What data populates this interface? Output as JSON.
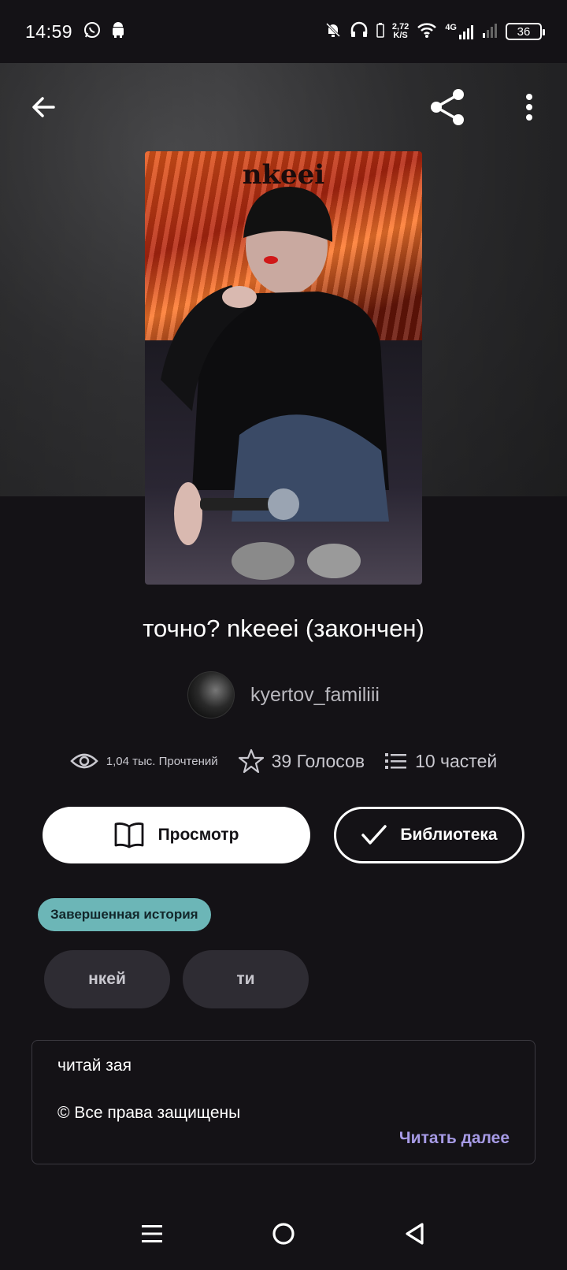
{
  "status_bar": {
    "time": "14:59",
    "net_speed_value": "2,72",
    "net_speed_unit": "K/S",
    "network_type": "4G",
    "battery": "36"
  },
  "story": {
    "cover_title": "nkeei",
    "title": "точно? nkeeei (закончен)",
    "author": "kyertov_familiii"
  },
  "stats": {
    "reads": "1,04 тыс. Прочтений",
    "votes": "39 Голосов",
    "parts": "10 частей"
  },
  "actions": {
    "read_label": "Просмотр",
    "library_label": "Библиотека"
  },
  "badge": "Завершенная история",
  "tags": [
    "нкей",
    "ти"
  ],
  "description": {
    "line1": "читай зая",
    "line2": "© Все права защищены",
    "read_more": "Читать далее"
  },
  "colors": {
    "background": "#141216",
    "badge": "#6cb6b7",
    "read_more": "#a79be6"
  }
}
